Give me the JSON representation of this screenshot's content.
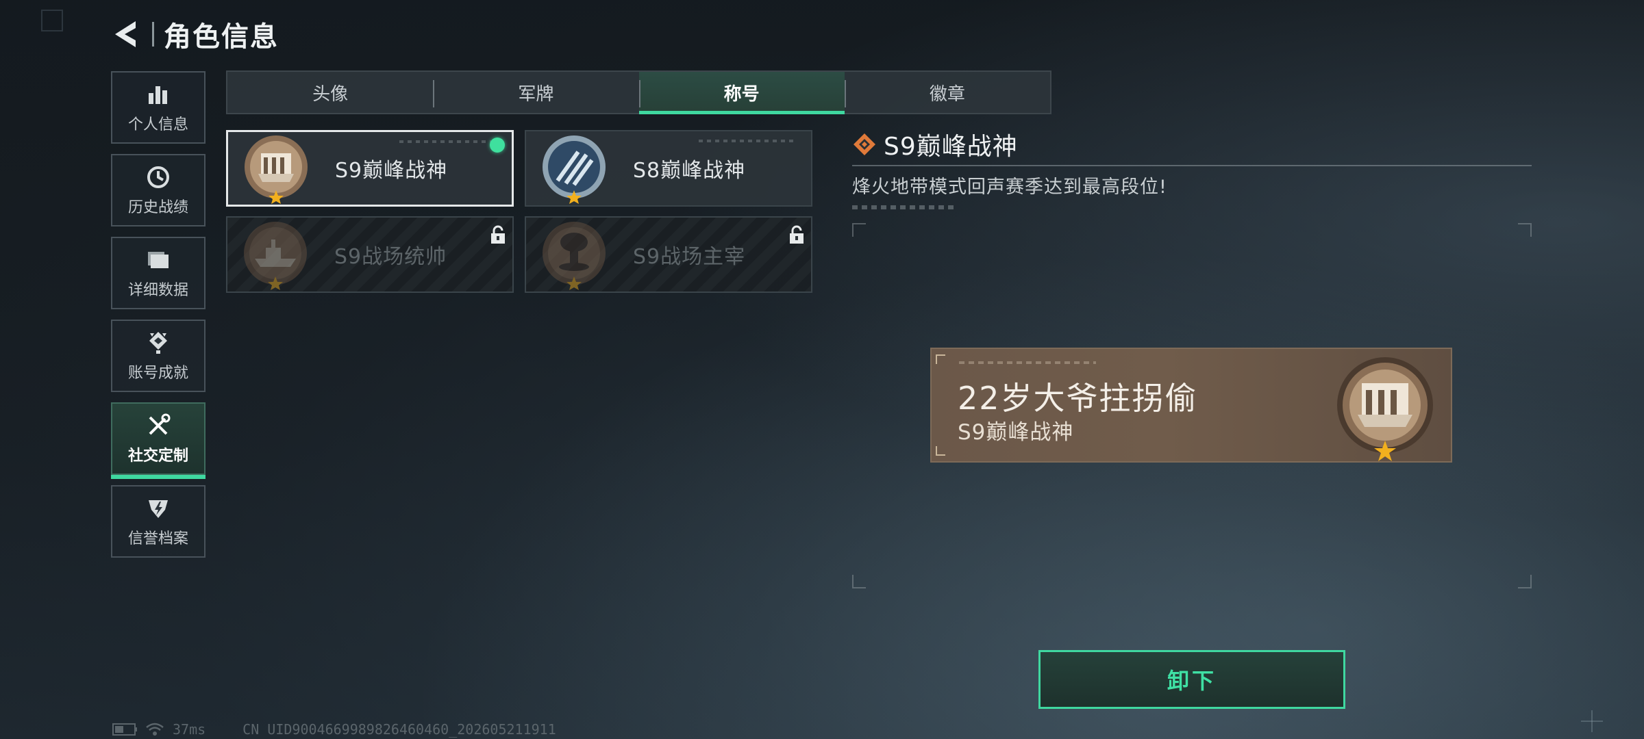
{
  "header": {
    "title": "角色信息"
  },
  "sidebar": {
    "items": [
      {
        "label": "个人信息",
        "icon": "bar-chart-icon"
      },
      {
        "label": "历史战绩",
        "icon": "clock-icon"
      },
      {
        "label": "详细数据",
        "icon": "folder-icon"
      },
      {
        "label": "账号成就",
        "icon": "achievement-icon"
      },
      {
        "label": "社交定制",
        "icon": "tools-icon",
        "active": true
      },
      {
        "label": "信誉档案",
        "icon": "shield-icon"
      }
    ]
  },
  "tabs": [
    {
      "label": "头像"
    },
    {
      "label": "军牌"
    },
    {
      "label": "称号",
      "active": true
    },
    {
      "label": "徽章"
    }
  ],
  "cards": [
    {
      "label": "S9巅峰战神",
      "selected": true,
      "equipped": true,
      "locked": false
    },
    {
      "label": "S8巅峰战神",
      "selected": false,
      "equipped": false,
      "locked": false
    },
    {
      "label": "S9战场统帅",
      "selected": false,
      "equipped": false,
      "locked": true
    },
    {
      "label": "S9战场主宰",
      "selected": false,
      "equipped": false,
      "locked": true
    }
  ],
  "detail": {
    "title": "S9巅峰战神",
    "description": "烽火地带模式回声赛季达到最高段位!"
  },
  "nameplate": {
    "player_name": "22岁大爷拄拐偷",
    "title": "S9巅峰战神"
  },
  "actions": {
    "unequip_label": "卸下"
  },
  "status": {
    "ping": "37ms",
    "uid": "CN UID9004669989826460460_202605211911"
  },
  "colors": {
    "accent": "#3fd8a0",
    "nameplate_bg": "#6b5849",
    "detail_icon": "#e07a3a"
  }
}
